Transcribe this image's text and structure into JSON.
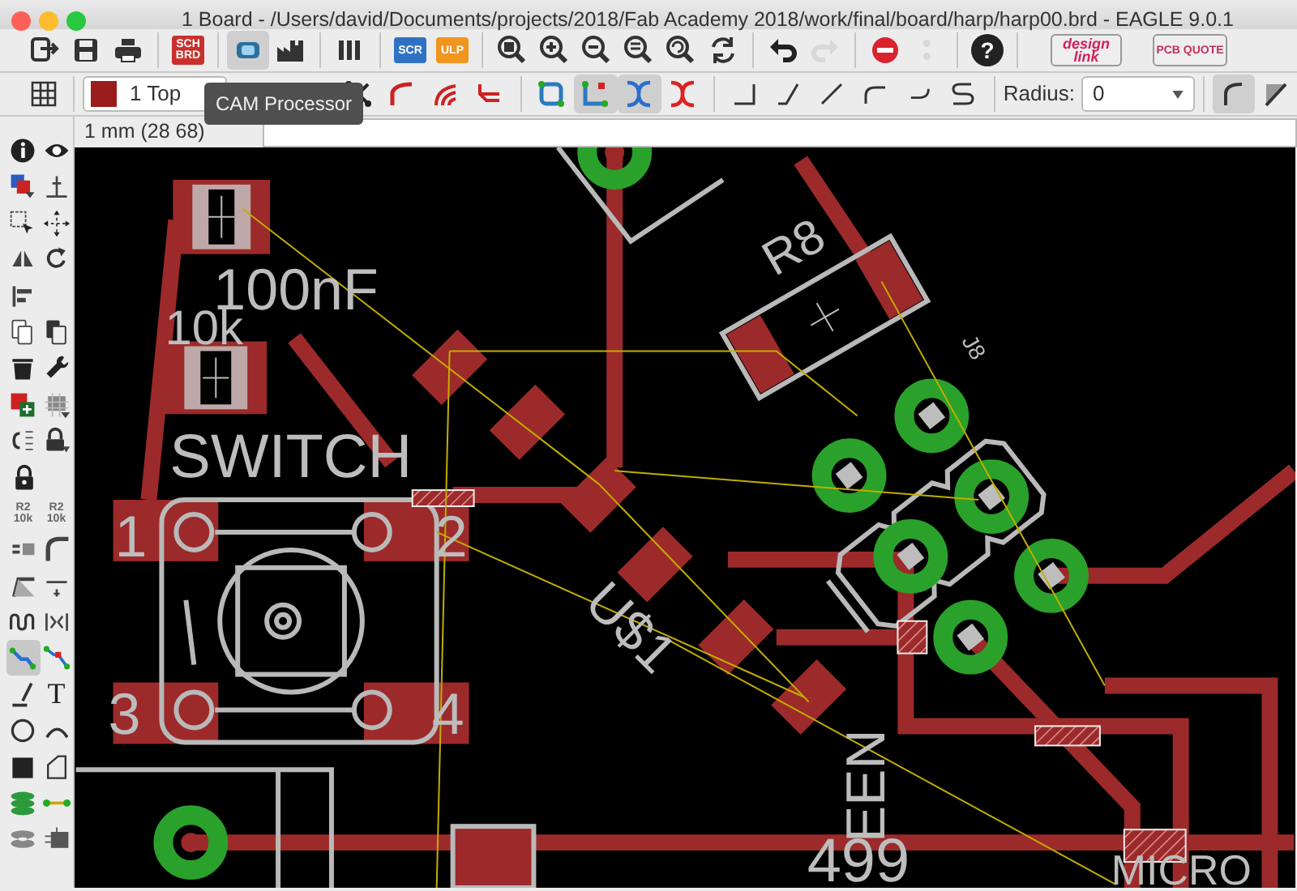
{
  "window": {
    "title": "1 Board - /Users/david/Documents/projects/2018/Fab Academy 2018/work/final/board/harp/harp00.brd - EAGLE 9.0.1"
  },
  "toolbar": [
    {
      "kind": "export",
      "selected": false,
      "disabled": false
    },
    {
      "kind": "save",
      "selected": false,
      "disabled": false
    },
    {
      "kind": "print",
      "selected": false,
      "disabled": false
    },
    {
      "kind": "sch-brd",
      "label": "SCH BRD",
      "selected": false,
      "disabled": false
    },
    {
      "kind": "cam",
      "selected": true,
      "disabled": false
    },
    {
      "kind": "factory",
      "selected": false,
      "disabled": false
    },
    {
      "kind": "library",
      "selected": false,
      "disabled": false
    },
    {
      "kind": "scr",
      "label": "SCR",
      "selected": false,
      "disabled": false
    },
    {
      "kind": "ulp",
      "label": "ULP",
      "selected": false,
      "disabled": false
    },
    {
      "kind": "zoom-fit",
      "selected": false,
      "disabled": false
    },
    {
      "kind": "zoom-in",
      "selected": false,
      "disabled": false
    },
    {
      "kind": "zoom-out",
      "selected": false,
      "disabled": false
    },
    {
      "kind": "zoom-select",
      "selected": false,
      "disabled": false
    },
    {
      "kind": "zoom-last",
      "selected": false,
      "disabled": false
    },
    {
      "kind": "redraw",
      "selected": false,
      "disabled": false
    },
    {
      "kind": "undo",
      "selected": false,
      "disabled": false
    },
    {
      "kind": "redo",
      "selected": false,
      "disabled": true
    },
    {
      "kind": "stop",
      "selected": false,
      "disabled": false
    },
    {
      "kind": "go",
      "selected": false,
      "disabled": true
    },
    {
      "kind": "help",
      "label": "?",
      "selected": false,
      "disabled": false
    },
    {
      "kind": "design-link",
      "label": "design link",
      "selected": false,
      "disabled": false
    },
    {
      "kind": "pcb-quote",
      "label": "PCB QUOTE",
      "selected": false,
      "disabled": false
    }
  ],
  "layer_select": {
    "value": "1 Top",
    "color": "#9b1c1c"
  },
  "tooltip": {
    "text": "CAM Processor"
  },
  "route_toolbar": [
    {
      "kind": "route-multi",
      "selected": false
    },
    {
      "kind": "route-curve",
      "selected": false
    },
    {
      "kind": "route-fan",
      "selected": false
    },
    {
      "kind": "route-diff",
      "selected": false
    },
    {
      "kind": "loop",
      "selected": false
    },
    {
      "kind": "loop-alt",
      "selected": true
    },
    {
      "kind": "crossover",
      "selected": true
    },
    {
      "kind": "crossover-remove",
      "selected": false
    },
    {
      "kind": "bend-right",
      "selected": false
    },
    {
      "kind": "bend-45",
      "selected": false
    },
    {
      "kind": "bend-straight",
      "selected": false
    },
    {
      "kind": "bend-arc",
      "selected": false
    },
    {
      "kind": "bend-arc-down",
      "selected": false
    },
    {
      "kind": "bend-s",
      "selected": false
    }
  ],
  "radius": {
    "label": "Radius:",
    "value": "0"
  },
  "wire_style_buttons": [
    {
      "kind": "round",
      "selected": true
    },
    {
      "kind": "angled",
      "selected": false
    }
  ],
  "coordinates": "1 mm (28 68)",
  "palette": [
    [
      {
        "kind": "info",
        "selected": false
      },
      {
        "kind": "eye",
        "selected": false
      }
    ],
    [
      {
        "kind": "layers",
        "selected": false
      },
      {
        "kind": "mark",
        "selected": false
      }
    ],
    [
      {
        "kind": "select",
        "selected": false
      },
      {
        "kind": "move",
        "selected": false
      }
    ],
    [
      {
        "kind": "mirror",
        "selected": false
      },
      {
        "kind": "rotate",
        "selected": false
      }
    ],
    [
      {
        "kind": "align",
        "selected": false
      }
    ],
    [
      {
        "kind": "copy",
        "selected": false
      },
      {
        "kind": "paste",
        "selected": false
      }
    ],
    [
      {
        "kind": "delete",
        "selected": false
      },
      {
        "kind": "wrench",
        "selected": false
      }
    ],
    [
      {
        "kind": "add",
        "selected": false
      },
      {
        "kind": "replace",
        "selected": false
      }
    ],
    [
      {
        "kind": "swap",
        "selected": false
      },
      {
        "kind": "lock-arrow",
        "selected": false
      }
    ],
    [
      {
        "kind": "lock",
        "selected": false
      }
    ],
    [
      {
        "kind": "name",
        "label": "R2 10k",
        "selected": false
      },
      {
        "kind": "value",
        "label": "R2 10k",
        "selected": false
      }
    ],
    [
      {
        "kind": "smash",
        "selected": false
      },
      {
        "kind": "miter",
        "selected": false
      }
    ],
    [
      {
        "kind": "split",
        "selected": false
      },
      {
        "kind": "optimize",
        "selected": false
      }
    ],
    [
      {
        "kind": "meander",
        "selected": false
      },
      {
        "kind": "spread",
        "selected": false
      }
    ],
    [
      {
        "kind": "route",
        "selected": true
      },
      {
        "kind": "ripup",
        "selected": false
      }
    ],
    [
      {
        "kind": "wire",
        "selected": false
      },
      {
        "kind": "text",
        "label": "T",
        "selected": false
      }
    ],
    [
      {
        "kind": "circle",
        "selected": false
      },
      {
        "kind": "arc",
        "selected": false
      }
    ],
    [
      {
        "kind": "rect",
        "selected": false
      },
      {
        "kind": "polygon",
        "selected": false
      }
    ],
    [
      {
        "kind": "via",
        "selected": false
      },
      {
        "kind": "signal",
        "selected": false
      }
    ],
    [
      {
        "kind": "hole",
        "selected": false
      },
      {
        "kind": "attribute",
        "selected": false
      }
    ]
  ],
  "board": {
    "labels": [
      "100nF",
      "10k",
      "SWITCH",
      "1",
      "2",
      "3",
      "4",
      "U$1",
      "R8",
      "J8",
      "EEN",
      "499",
      "MICRO"
    ]
  }
}
